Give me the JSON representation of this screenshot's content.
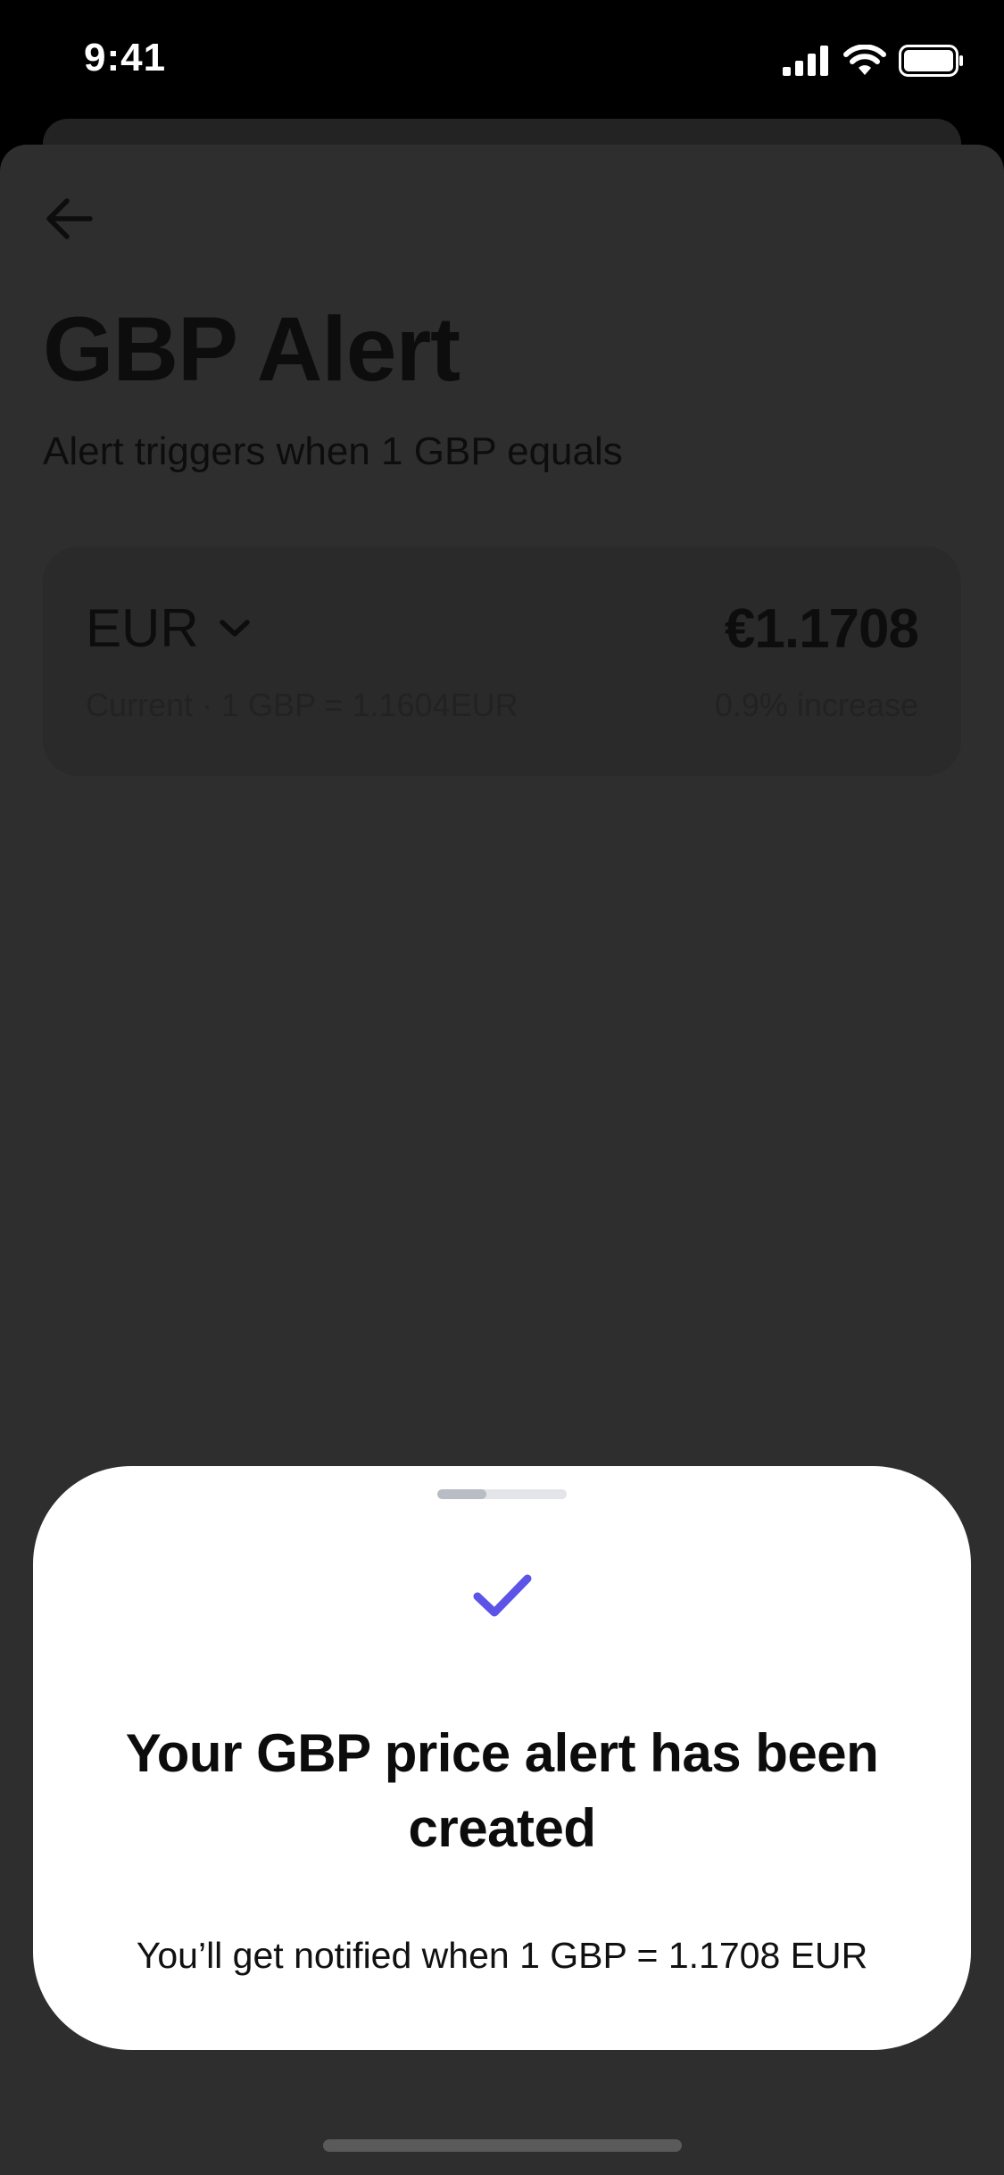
{
  "status_bar": {
    "time": "9:41"
  },
  "header": {
    "title": "GBP Alert",
    "subtitle": "Alert triggers when 1 GBP equals"
  },
  "alert_card": {
    "currency": "EUR",
    "target_value": "€1.1708",
    "current_rate": "Current · 1 GBP = 1.1604EUR",
    "change": "0.9% increase"
  },
  "modal": {
    "title": "Your GBP price alert has been created",
    "message": "You’ll get notified when 1 GBP = 1.1708 EUR",
    "handle_progress": 0.38,
    "accent_color": "#5b54e6"
  },
  "icons": {
    "back": "arrow-left-icon",
    "chevron": "chevron-down-icon",
    "check": "check-icon",
    "signal": "signal-icon",
    "wifi": "wifi-icon",
    "battery": "battery-icon"
  }
}
